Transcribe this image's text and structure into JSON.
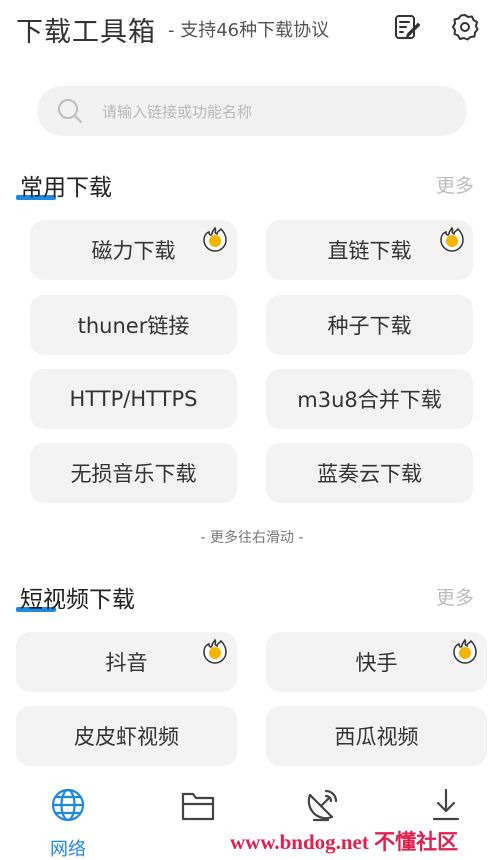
{
  "header": {
    "title": "下载工具箱",
    "subtitle": "- 支持46种下载协议",
    "edit_icon": "edit-note-icon",
    "settings_icon": "gear-icon"
  },
  "search": {
    "placeholder": "请输入链接或功能名称",
    "icon": "search-icon"
  },
  "common": {
    "title": "常用下载",
    "more": "更多",
    "items": [
      {
        "label": "磁力下载",
        "hot": true
      },
      {
        "label": "直链下载",
        "hot": true
      },
      {
        "label": "thuner链接",
        "hot": false
      },
      {
        "label": "种子下载",
        "hot": false
      },
      {
        "label": "HTTP/HTTPS",
        "hot": false
      },
      {
        "label": "m3u8合并下载",
        "hot": false
      },
      {
        "label": "无损音乐下载",
        "hot": false
      },
      {
        "label": "蓝奏云下载",
        "hot": false
      }
    ],
    "hint": "- 更多往右滑动 -"
  },
  "short_video": {
    "title": "短视频下载",
    "more": "更多",
    "items": [
      {
        "label": "抖音",
        "hot": true
      },
      {
        "label": "快手",
        "hot": true
      },
      {
        "label": "皮皮虾视频",
        "hot": false
      },
      {
        "label": "西瓜视频",
        "hot": false
      }
    ]
  },
  "nav": {
    "items": [
      {
        "label": "网络",
        "icon": "globe-icon",
        "active": true
      },
      {
        "label": "",
        "icon": "folder-icon",
        "active": false
      },
      {
        "label": "",
        "icon": "satellite-icon",
        "active": false
      },
      {
        "label": "",
        "icon": "download-icon",
        "active": false
      }
    ]
  },
  "watermark": "www.bndog.net 不懂社区",
  "colors": {
    "accent": "#1e88e5",
    "button_bg": "#f3f3f3",
    "hot": "#f5b400",
    "watermark": "#e0204f"
  }
}
